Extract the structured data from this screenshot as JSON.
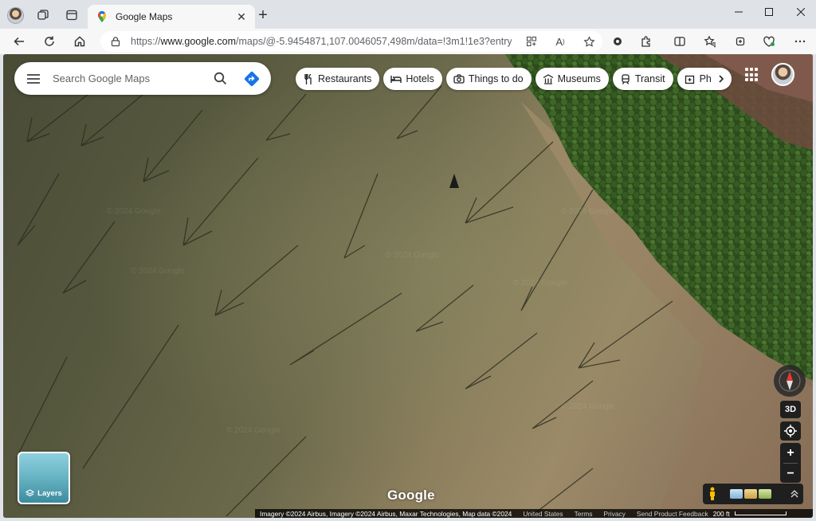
{
  "browser": {
    "tab_title": "Google Maps",
    "url_prefix": "https://",
    "url_host": "www.google.com",
    "url_path": "/maps/@-5.9454871,107.0046057,498m/data=!3m1!1e3?entry=..."
  },
  "maps": {
    "search_placeholder": "Search Google Maps",
    "chips": [
      {
        "label": "Restaurants",
        "icon": "fork-knife-icon"
      },
      {
        "label": "Hotels",
        "icon": "bed-icon"
      },
      {
        "label": "Things to do",
        "icon": "camera-icon"
      },
      {
        "label": "Museums",
        "icon": "museum-icon"
      },
      {
        "label": "Transit",
        "icon": "train-icon"
      },
      {
        "label": "Ph",
        "icon": "pharmacy-icon"
      }
    ],
    "view_3d_label": "3D",
    "layers_label": "Layers",
    "logo_text": "Google",
    "watermark": "© 2024 Google",
    "footer": {
      "imagery": "Imagery ©2024 Airbus, Imagery ©2024 Airbus, Maxar Technologies, Map data ©2024",
      "links": [
        "United States",
        "Terms",
        "Privacy",
        "Send Product Feedback"
      ],
      "scale": "200 ft"
    }
  },
  "colors": {
    "water": "#56583e",
    "forest": "#2f4f1f",
    "chip_bg": "#ffffff",
    "control_bg": "#1f1f1f",
    "directions_blue": "#1a73e8"
  }
}
